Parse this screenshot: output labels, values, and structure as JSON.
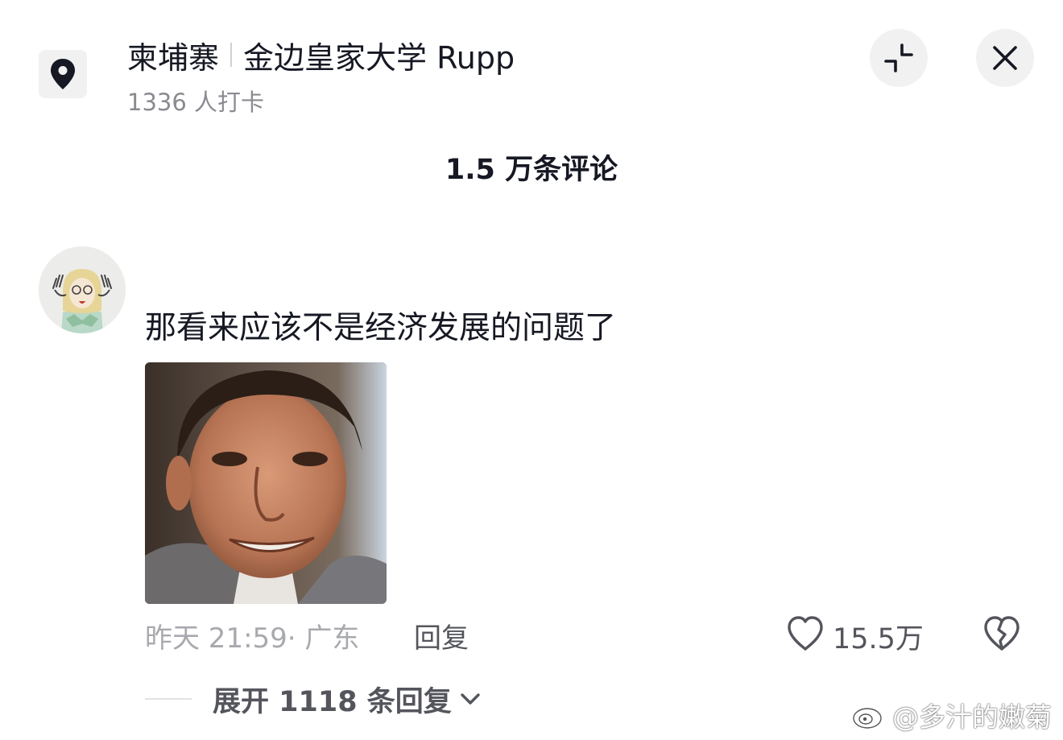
{
  "header": {
    "country": "柬埔寨",
    "place": "金边皇家大学 Rupp",
    "checkin": "1336 人打卡"
  },
  "comments_header": {
    "count_label": "1.5 万条评论"
  },
  "comment": {
    "text": "那看来应该不是经济发展的问题了",
    "meta": "昨天 21:59· 广东",
    "reply_label": "回复",
    "likes": "15.5万",
    "expand_label": "展开 1118 条回复"
  },
  "watermark": {
    "text": "@多汁的嫩菊"
  },
  "icons": {
    "location": "location-pin-icon",
    "collapse": "collapse-icon",
    "close": "close-icon",
    "like": "heart-icon",
    "dislike": "broken-heart-icon",
    "expand": "chevron-down-icon",
    "weibo": "weibo-logo"
  }
}
